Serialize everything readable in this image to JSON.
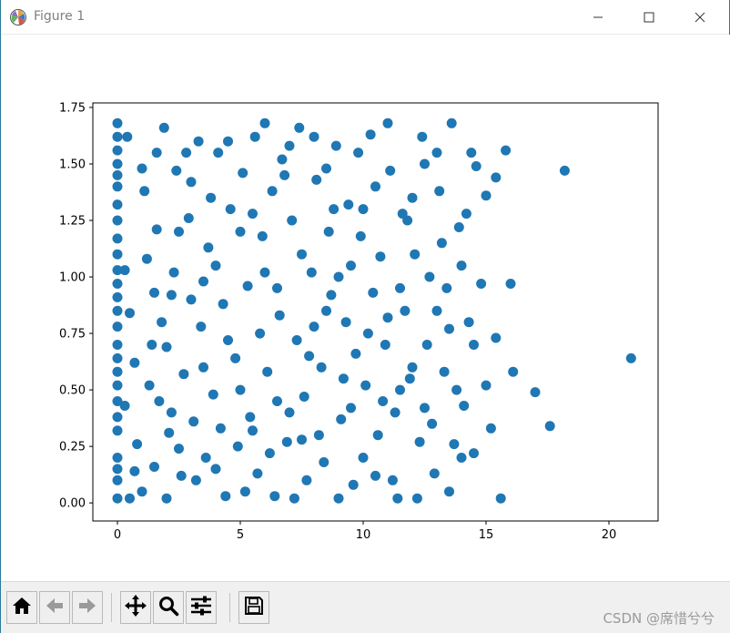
{
  "window": {
    "title": "Figure 1",
    "icons": {
      "app": "matplotlib-logo-icon",
      "minimize": "minimize-icon",
      "maximize": "maximize-icon",
      "close": "close-icon"
    }
  },
  "toolbar": {
    "buttons": [
      {
        "name": "home-button",
        "icon": "home-icon"
      },
      {
        "name": "back-button",
        "icon": "arrow-left-icon"
      },
      {
        "name": "forward-button",
        "icon": "arrow-right-icon"
      },
      {
        "name": "pan-button",
        "icon": "move-icon"
      },
      {
        "name": "zoom-button",
        "icon": "magnifier-icon"
      },
      {
        "name": "configure-subplots-button",
        "icon": "sliders-icon"
      },
      {
        "name": "save-button",
        "icon": "floppy-disk-icon"
      }
    ]
  },
  "watermark": "CSDN @席惜兮兮",
  "colors": {
    "marker": "#1f77b4",
    "frame": "#000000",
    "toolbar_bg": "#f0f0f0"
  },
  "chart_data": {
    "type": "scatter",
    "title": "",
    "xlabel": "",
    "ylabel": "",
    "xlim": [
      -1,
      22
    ],
    "ylim": [
      -0.08,
      1.77
    ],
    "xticks": [
      0,
      5,
      10,
      15,
      20
    ],
    "xtick_labels": [
      "0",
      "5",
      "10",
      "15",
      "20"
    ],
    "yticks": [
      0.0,
      0.25,
      0.5,
      0.75,
      1.0,
      1.25,
      1.5,
      1.75
    ],
    "ytick_labels": [
      "0.00",
      "0.25",
      "0.50",
      "0.75",
      "1.00",
      "1.25",
      "1.50",
      "1.75"
    ],
    "grid": false,
    "series": [
      {
        "color": "#1f77b4",
        "points": [
          [
            0,
            0.02
          ],
          [
            0,
            0.1
          ],
          [
            0,
            0.2
          ],
          [
            0,
            0.32
          ],
          [
            0,
            0.45
          ],
          [
            0,
            0.58
          ],
          [
            0,
            0.7
          ],
          [
            0,
            0.85
          ],
          [
            0,
            0.97
          ],
          [
            0,
            1.1
          ],
          [
            0,
            1.25
          ],
          [
            0,
            1.4
          ],
          [
            0,
            1.5
          ],
          [
            0,
            1.62
          ],
          [
            0,
            1.68
          ],
          [
            0.5,
            0.02
          ],
          [
            0.4,
            1.62
          ],
          [
            1.0,
            1.48
          ],
          [
            0.8,
            0.26
          ],
          [
            0.7,
            0.62
          ],
          [
            1.5,
            0.16
          ],
          [
            1.2,
            1.08
          ],
          [
            2.0,
            0.02
          ],
          [
            2.2,
            0.4
          ],
          [
            1.8,
            0.8
          ],
          [
            2.5,
            1.2
          ],
          [
            2.8,
            1.55
          ],
          [
            3.0,
            0.9
          ],
          [
            3.2,
            0.1
          ],
          [
            3.5,
            0.6
          ],
          [
            3.8,
            1.35
          ],
          [
            4.2,
            0.33
          ],
          [
            4.0,
            1.05
          ],
          [
            4.5,
            1.6
          ],
          [
            5.0,
            0.5
          ],
          [
            5.2,
            0.05
          ],
          [
            5.5,
            1.28
          ],
          [
            5.8,
            0.75
          ],
          [
            6.0,
            1.68
          ],
          [
            6.2,
            0.22
          ],
          [
            6.5,
            0.95
          ],
          [
            6.8,
            1.45
          ],
          [
            7.0,
            0.4
          ],
          [
            7.2,
            0.02
          ],
          [
            7.5,
            1.1
          ],
          [
            7.8,
            0.65
          ],
          [
            8.0,
            1.62
          ],
          [
            8.2,
            0.3
          ],
          [
            8.5,
            0.85
          ],
          [
            8.8,
            1.3
          ],
          [
            9.0,
            0.02
          ],
          [
            9.2,
            0.55
          ],
          [
            9.5,
            1.05
          ],
          [
            9.8,
            1.55
          ],
          [
            10.0,
            0.2
          ],
          [
            10.2,
            0.75
          ],
          [
            10.5,
            1.4
          ],
          [
            10.8,
            0.45
          ],
          [
            11.0,
            1.68
          ],
          [
            11.2,
            0.1
          ],
          [
            11.5,
            0.95
          ],
          [
            11.8,
            1.25
          ],
          [
            12.0,
            0.6
          ],
          [
            12.2,
            0.02
          ],
          [
            12.5,
            1.5
          ],
          [
            12.8,
            0.35
          ],
          [
            13.0,
            0.85
          ],
          [
            13.2,
            1.15
          ],
          [
            13.5,
            0.05
          ],
          [
            13.6,
            1.68
          ],
          [
            13.8,
            0.5
          ],
          [
            14.0,
            0.2
          ],
          [
            14.2,
            1.28
          ],
          [
            14.5,
            0.7
          ],
          [
            14.6,
            1.49
          ],
          [
            14.8,
            0.97
          ],
          [
            15.0,
            1.36
          ],
          [
            15.2,
            0.33
          ],
          [
            15.4,
            1.44
          ],
          [
            15.4,
            0.73
          ],
          [
            15.6,
            0.02
          ],
          [
            15.8,
            1.56
          ],
          [
            16.0,
            0.97
          ],
          [
            16.1,
            0.58
          ],
          [
            17.0,
            0.49
          ],
          [
            17.6,
            0.34
          ],
          [
            18.2,
            1.47
          ],
          [
            20.9,
            0.64
          ],
          [
            0.5,
            0.84
          ],
          [
            0.7,
            0.14
          ],
          [
            1.0,
            0.05
          ],
          [
            1.1,
            1.38
          ],
          [
            1.3,
            0.52
          ],
          [
            1.5,
            0.93
          ],
          [
            1.6,
            1.21
          ],
          [
            1.7,
            0.45
          ],
          [
            1.9,
            1.66
          ],
          [
            2.0,
            0.69
          ],
          [
            2.1,
            0.31
          ],
          [
            2.3,
            1.02
          ],
          [
            2.4,
            1.47
          ],
          [
            2.6,
            0.12
          ],
          [
            2.7,
            0.57
          ],
          [
            2.9,
            1.26
          ],
          [
            3.1,
            0.36
          ],
          [
            3.3,
            1.6
          ],
          [
            3.4,
            0.78
          ],
          [
            3.6,
            0.2
          ],
          [
            3.7,
            1.13
          ],
          [
            3.9,
            0.48
          ],
          [
            4.1,
            1.55
          ],
          [
            4.3,
            0.88
          ],
          [
            4.4,
            0.03
          ],
          [
            4.6,
            1.3
          ],
          [
            4.8,
            0.64
          ],
          [
            4.9,
            0.25
          ],
          [
            5.1,
            1.46
          ],
          [
            5.3,
            0.96
          ],
          [
            5.4,
            0.38
          ],
          [
            5.6,
            1.62
          ],
          [
            5.7,
            0.13
          ],
          [
            5.9,
            1.18
          ],
          [
            6.1,
            0.58
          ],
          [
            6.3,
            1.38
          ],
          [
            6.4,
            0.03
          ],
          [
            6.6,
            0.83
          ],
          [
            6.7,
            1.52
          ],
          [
            6.9,
            0.27
          ],
          [
            7.1,
            1.25
          ],
          [
            7.3,
            0.72
          ],
          [
            7.4,
            1.66
          ],
          [
            7.6,
            0.47
          ],
          [
            7.7,
            0.1
          ],
          [
            7.9,
            1.02
          ],
          [
            8.1,
            1.43
          ],
          [
            8.3,
            0.6
          ],
          [
            8.4,
            0.18
          ],
          [
            8.6,
            1.2
          ],
          [
            8.7,
            0.92
          ],
          [
            8.9,
            1.58
          ],
          [
            9.1,
            0.37
          ],
          [
            9.3,
            0.8
          ],
          [
            9.4,
            1.32
          ],
          [
            9.6,
            0.08
          ],
          [
            9.7,
            0.66
          ],
          [
            9.9,
            1.18
          ],
          [
            10.1,
            0.52
          ],
          [
            10.3,
            1.63
          ],
          [
            10.4,
            0.93
          ],
          [
            10.6,
            0.3
          ],
          [
            10.7,
            1.09
          ],
          [
            10.9,
            0.7
          ],
          [
            11.1,
            1.47
          ],
          [
            11.3,
            0.4
          ],
          [
            11.4,
            0.02
          ],
          [
            11.6,
            1.28
          ],
          [
            11.7,
            0.85
          ],
          [
            11.9,
            0.55
          ],
          [
            12.1,
            1.1
          ],
          [
            12.3,
            0.27
          ],
          [
            12.4,
            1.62
          ],
          [
            12.6,
            0.7
          ],
          [
            12.7,
            1.0
          ],
          [
            12.9,
            0.13
          ],
          [
            13.1,
            1.38
          ],
          [
            13.3,
            0.58
          ],
          [
            13.4,
            0.95
          ],
          [
            13.7,
            0.26
          ],
          [
            13.9,
            1.22
          ],
          [
            14.1,
            0.43
          ],
          [
            14.3,
            0.8
          ],
          [
            14.4,
            1.55
          ],
          [
            0,
            0.15
          ],
          [
            0,
            0.38
          ],
          [
            0,
            0.52
          ],
          [
            0,
            0.64
          ],
          [
            0,
            0.78
          ],
          [
            0,
            0.91
          ],
          [
            0,
            1.03
          ],
          [
            0,
            1.17
          ],
          [
            0,
            1.32
          ],
          [
            0,
            1.45
          ],
          [
            0,
            1.56
          ],
          [
            0.3,
            0.43
          ],
          [
            0.3,
            1.03
          ],
          [
            1.4,
            0.7
          ],
          [
            1.6,
            1.55
          ],
          [
            2.2,
            0.92
          ],
          [
            2.5,
            0.24
          ],
          [
            3.0,
            1.42
          ],
          [
            3.5,
            0.98
          ],
          [
            4.0,
            0.15
          ],
          [
            4.5,
            0.72
          ],
          [
            5.0,
            1.2
          ],
          [
            5.5,
            0.32
          ],
          [
            6.0,
            1.02
          ],
          [
            6.5,
            0.45
          ],
          [
            7.0,
            1.58
          ],
          [
            7.5,
            0.28
          ],
          [
            8.0,
            0.78
          ],
          [
            8.5,
            1.48
          ],
          [
            9.0,
            1.0
          ],
          [
            9.5,
            0.42
          ],
          [
            10.0,
            1.3
          ],
          [
            10.5,
            0.12
          ],
          [
            11.0,
            0.82
          ],
          [
            11.5,
            0.5
          ],
          [
            12.0,
            1.35
          ],
          [
            12.5,
            0.42
          ],
          [
            13.0,
            1.55
          ],
          [
            13.5,
            0.77
          ],
          [
            14.0,
            1.05
          ],
          [
            14.5,
            0.22
          ],
          [
            15.0,
            0.52
          ]
        ]
      }
    ]
  }
}
